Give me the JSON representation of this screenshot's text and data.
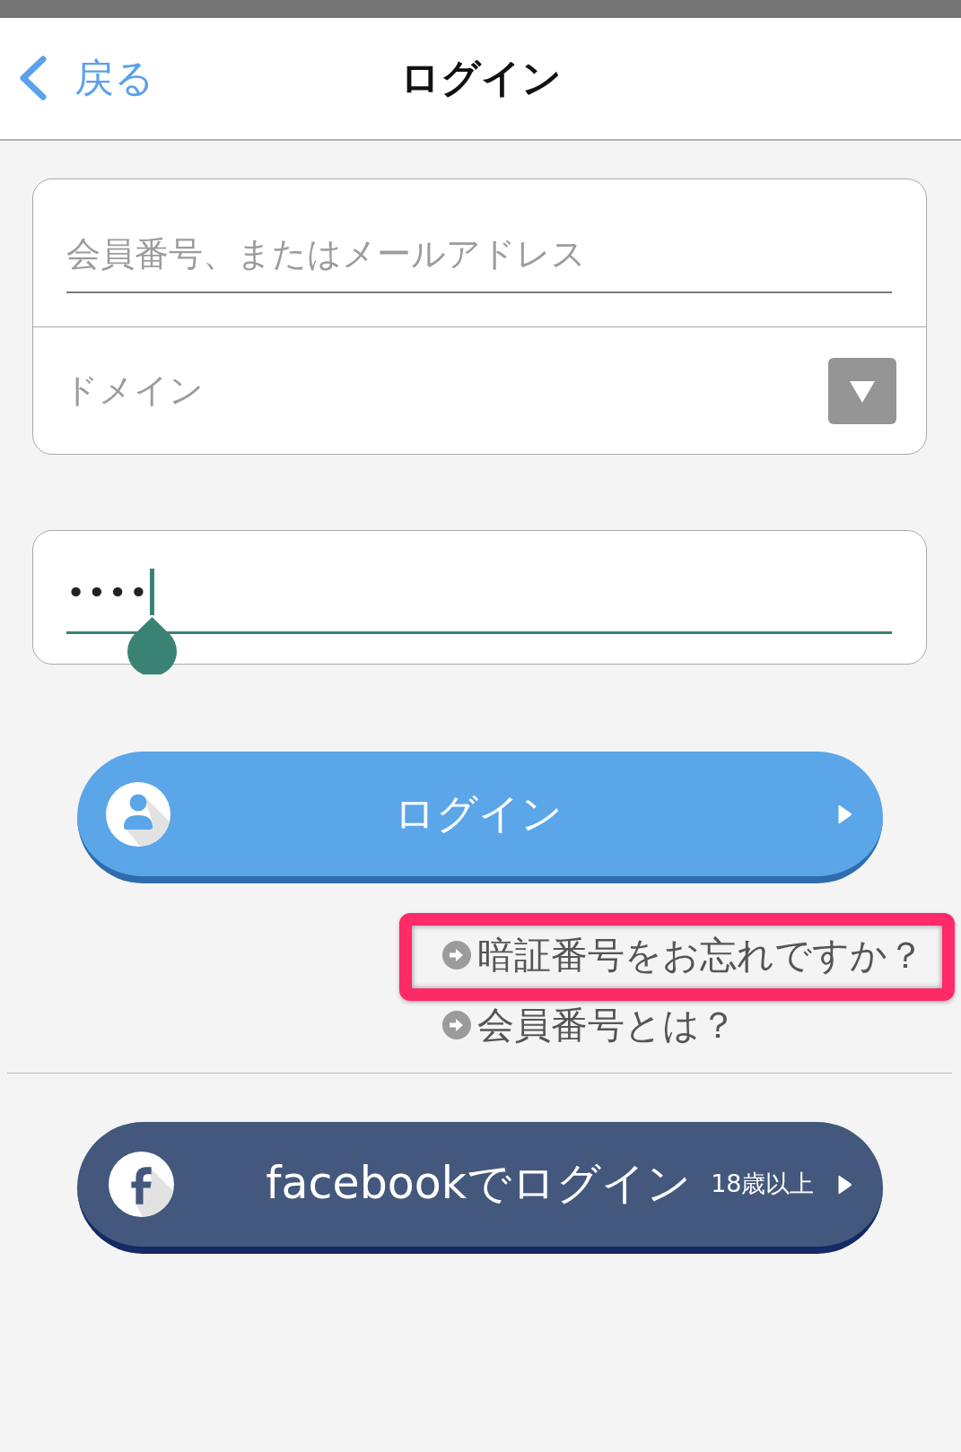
{
  "header": {
    "back": {
      "label": "戻る"
    },
    "title": "ログイン"
  },
  "login_form": {
    "member_id": {
      "placeholder": "会員番号、またはメールアドレス",
      "focused": false
    },
    "domain": {
      "placeholder": "ドメイン"
    },
    "pin": {
      "value": "••••",
      "focused": true
    }
  },
  "login_button": {
    "label": "ログイン"
  },
  "links": [
    {
      "label": "暗証番号をお忘れですか？",
      "highlighted": true
    },
    {
      "label": "会員番号とは？",
      "highlighted": false
    }
  ],
  "facebook_button": {
    "label": "facebookでログイン",
    "note": "18歳以上"
  }
}
